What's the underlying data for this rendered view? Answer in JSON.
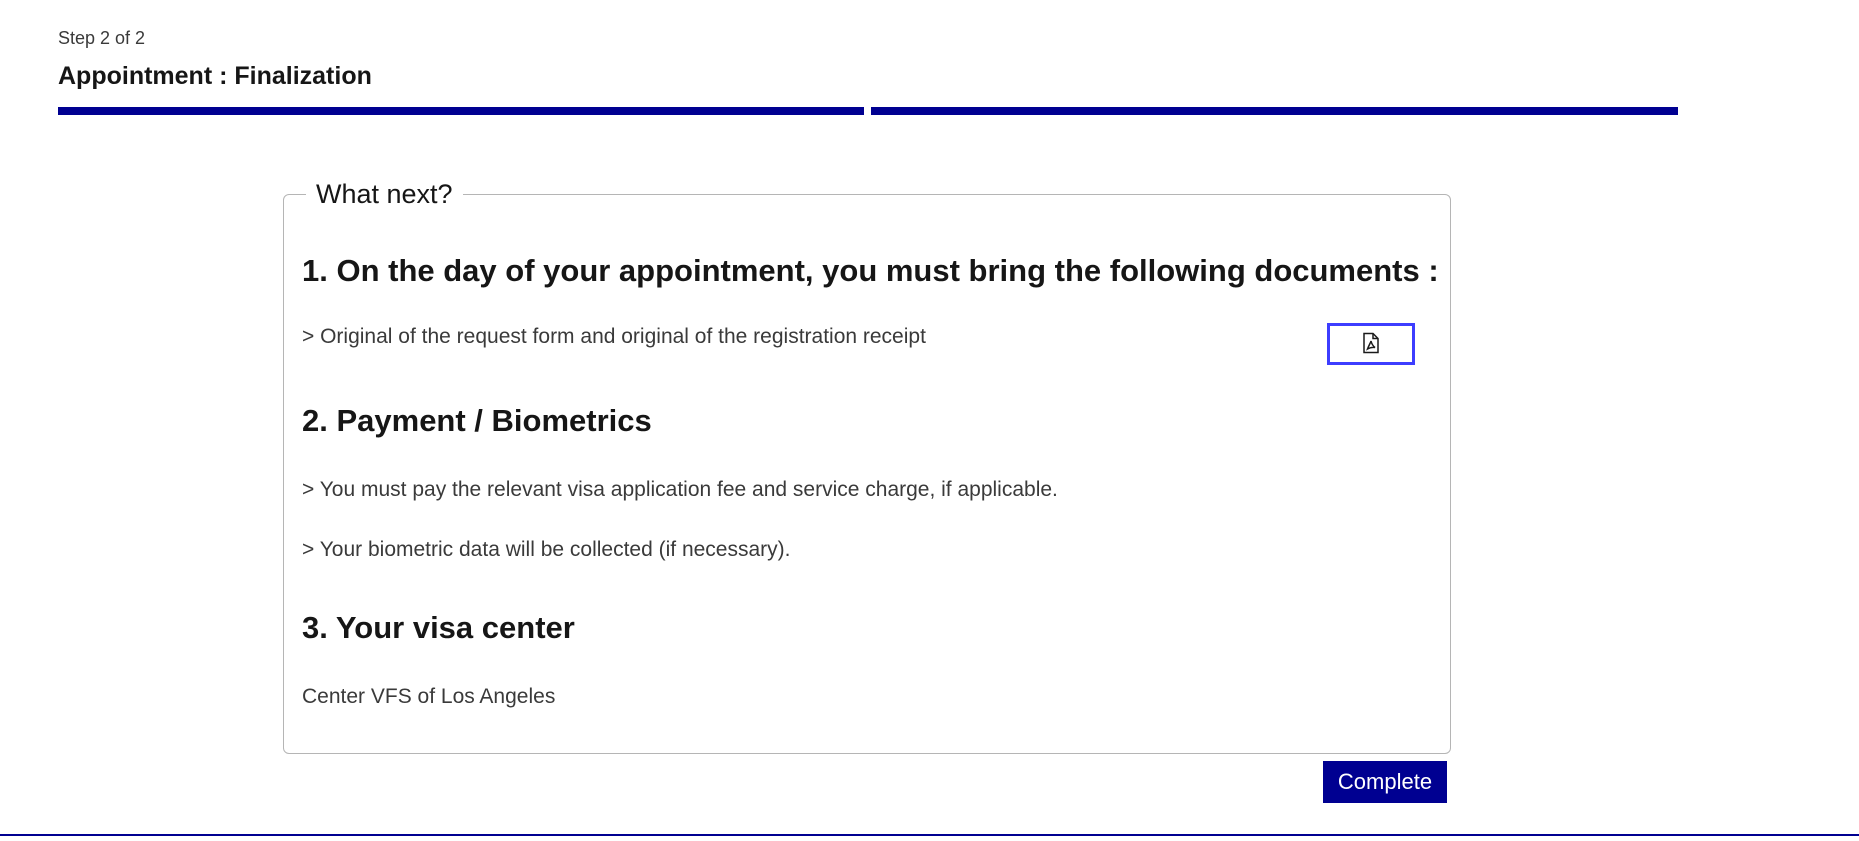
{
  "stepper": {
    "step_label": "Step 2 of 2",
    "title": "Appointment : Finalization",
    "progress_total_steps": 2,
    "progress_completed_steps": 2,
    "accent_color": "#000091"
  },
  "panel": {
    "legend": "What next?",
    "section1_title": "1. On the day of your appointment, you must bring the following documents :",
    "section1_item": "> Original of the request form and original of the registration receipt",
    "pdf_button_icon": "pdf-file-icon",
    "section2_title": "2. Payment / Biometrics",
    "section2_item1": "> You must pay the relevant visa application fee and service charge, if applicable.",
    "section2_item2": "> Your biometric data will be collected (if necessary).",
    "section3_title": "3. Your visa center",
    "section3_item": "Center VFS of Los Angeles"
  },
  "actions": {
    "complete_label": "Complete"
  }
}
